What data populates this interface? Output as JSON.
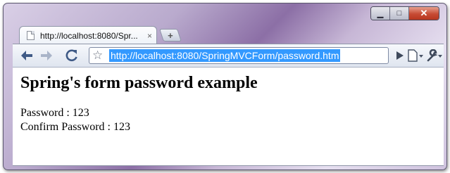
{
  "window": {
    "minimize_symbol": "▁",
    "maximize_symbol": "□",
    "close_symbol": "✕"
  },
  "tab": {
    "title": "http://localhost:8080/Spr...",
    "close_symbol": "×"
  },
  "new_tab": {
    "symbol": "+"
  },
  "toolbar": {
    "back_icon": "back-arrow-icon",
    "forward_icon": "forward-arrow-icon",
    "reload_icon": "reload-icon",
    "bookmark_icon": "star-icon",
    "url": "http://localhost:8080/SpringMVCForm/password.htm",
    "go_icon": "play-icon",
    "page_menu_icon": "page-icon",
    "tools_menu_icon": "wrench-icon"
  },
  "page": {
    "heading": "Spring's form password example",
    "password_line": "Password : 123",
    "confirm_line": "Confirm Password : 123"
  },
  "colors": {
    "selection": "#3399ff",
    "close_button": "#c74b34"
  }
}
